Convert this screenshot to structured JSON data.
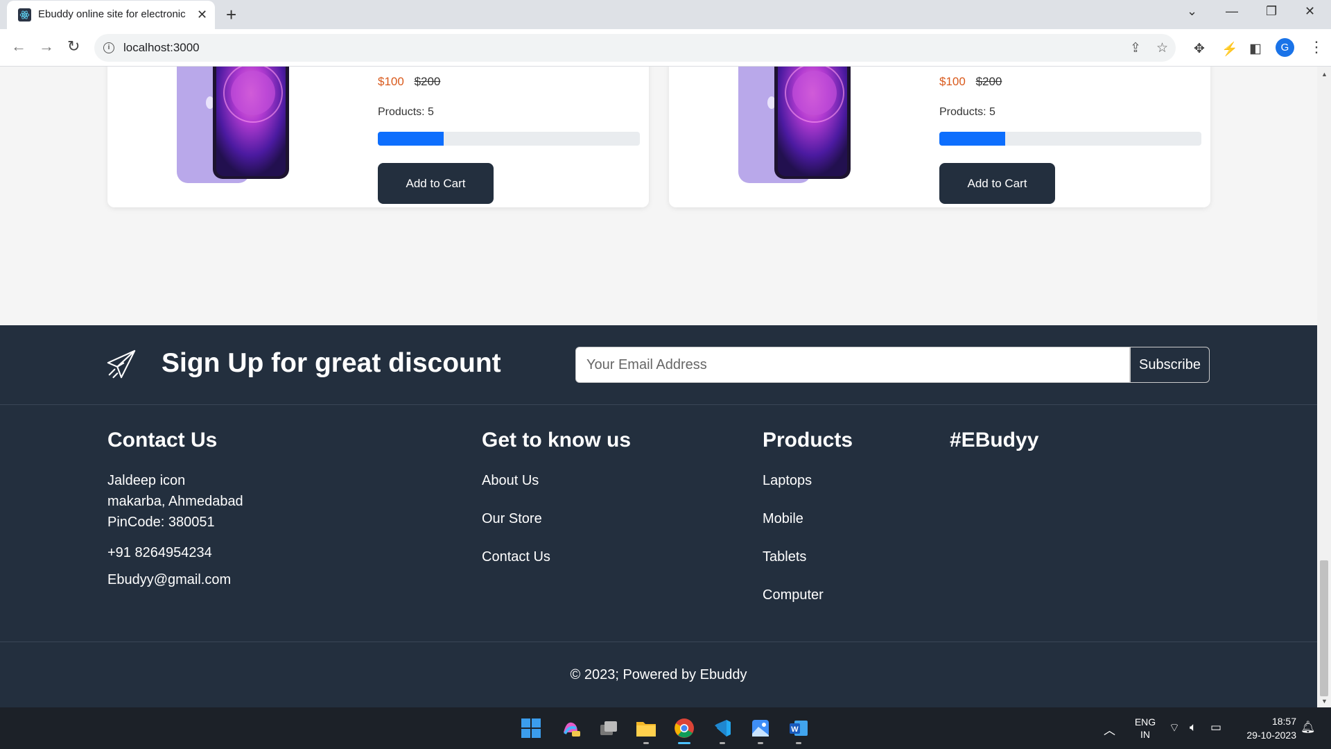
{
  "browser": {
    "tab_title": "Ebuddy online site for electronic",
    "url": "localhost:3000",
    "profile_initial": "G"
  },
  "products": [
    {
      "price": "$100",
      "old_price": "$200",
      "stock_label": "Products: 5",
      "progress_fraction": 0.25,
      "cart_label": "Add to Cart"
    },
    {
      "price": "$100",
      "old_price": "$200",
      "stock_label": "Products: 5",
      "progress_fraction": 0.25,
      "cart_label": "Add to Cart"
    }
  ],
  "newsletter": {
    "title": "Sign Up for great discount",
    "email_placeholder": "Your Email Address",
    "subscribe_label": "Subscribe"
  },
  "footer": {
    "contact": {
      "title": "Contact Us",
      "address_lines": [
        "Jaldeep icon",
        "makarba, Ahmedabad",
        "PinCode: 380051"
      ],
      "phone": "+91 8264954234",
      "email": "Ebudyy@gmail.com"
    },
    "know": {
      "title": "Get to know us",
      "links": [
        "About Us",
        "Our Store",
        "Contact Us"
      ]
    },
    "products": {
      "title": "Products",
      "links": [
        "Laptops",
        "Mobile",
        "Tablets",
        "Computer"
      ]
    },
    "social": {
      "title": "#EBudyy"
    },
    "copyright": "© 2023; Powered by Ebuddy"
  },
  "taskbar": {
    "lang_top": "ENG",
    "lang_bottom": "IN",
    "time": "18:57",
    "date": "29-10-2023"
  },
  "colors": {
    "footer_bg": "#232f3e",
    "accent_blue": "#0d6efd",
    "price_orange": "#d9591b"
  }
}
